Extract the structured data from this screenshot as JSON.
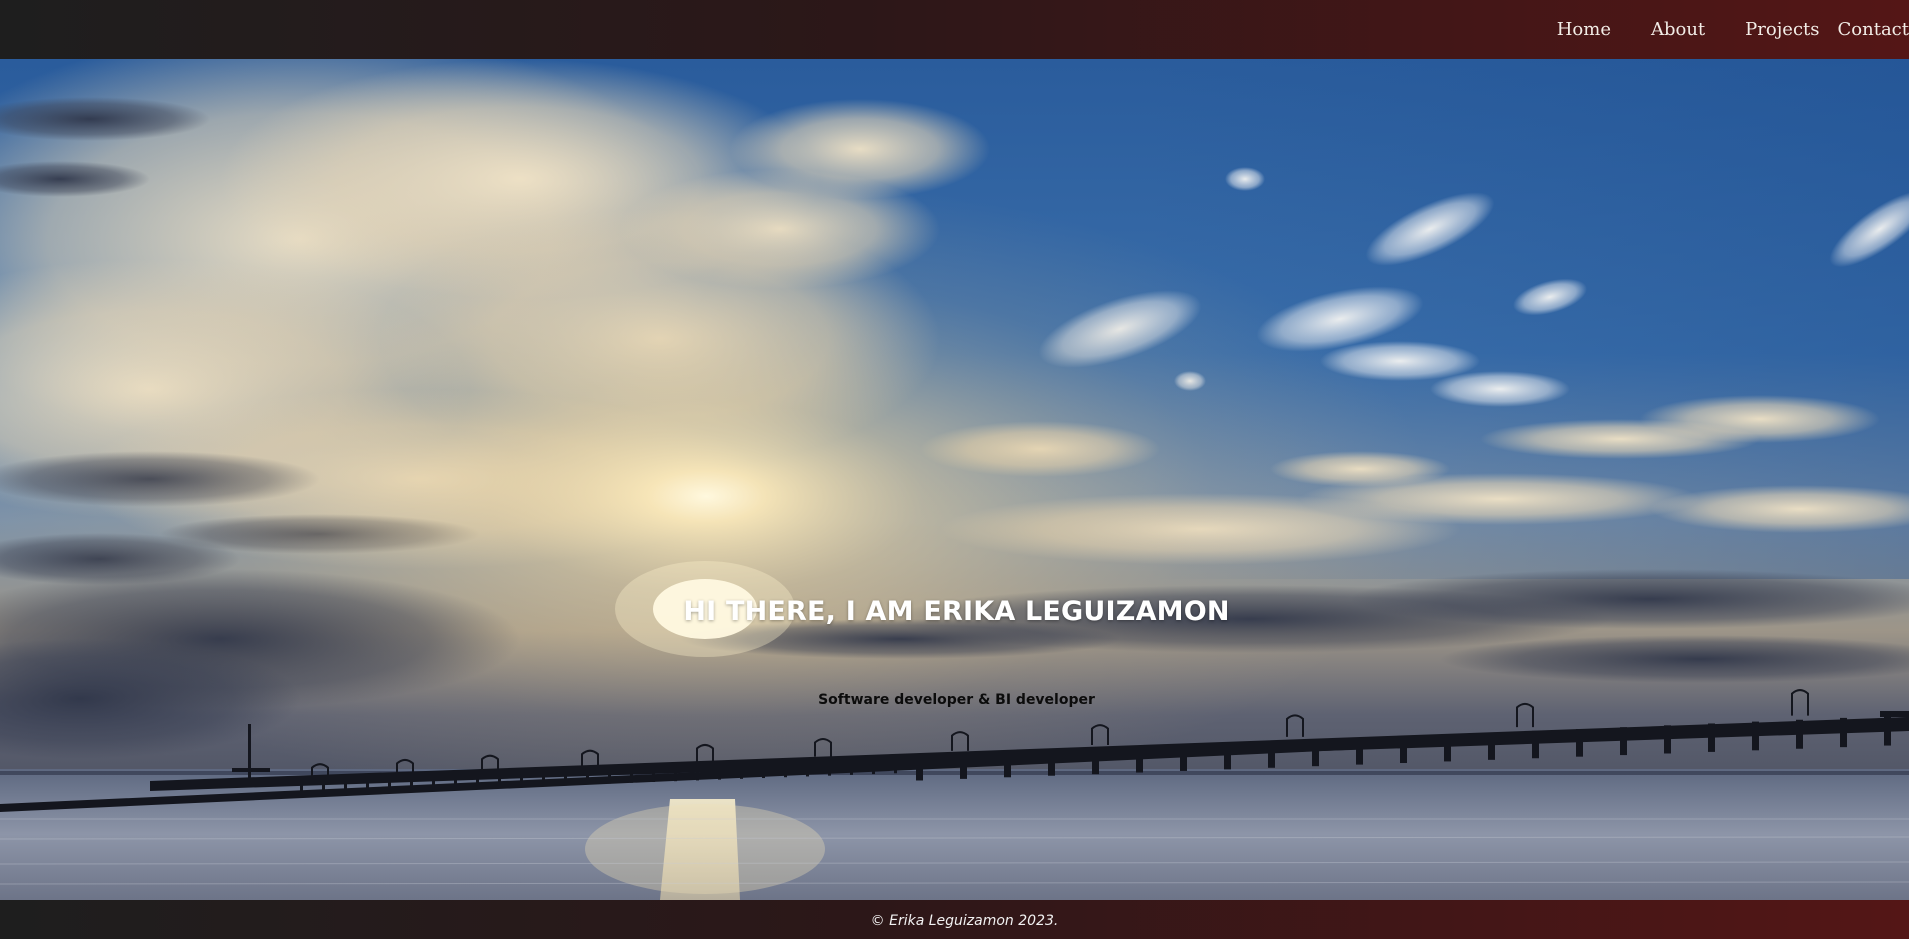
{
  "nav": {
    "items": [
      {
        "label": "Home"
      },
      {
        "label": "About"
      },
      {
        "label": "Projects"
      },
      {
        "label": "Contact"
      }
    ]
  },
  "hero": {
    "title": "HI THERE, I AM ERIKA LEGUIZAMON",
    "subtitle": "Software developer & BI developer",
    "background": "sunset-over-pier-photo"
  },
  "footer": {
    "copyright": "© Erika Leguizamon 2023."
  },
  "colors": {
    "bar_gradient_start": "#1e1e1e",
    "bar_gradient_end": "#541616",
    "nav_text": "#f2ece6",
    "hero_title": "#ffffff",
    "hero_subtitle": "#0c0c0c"
  }
}
